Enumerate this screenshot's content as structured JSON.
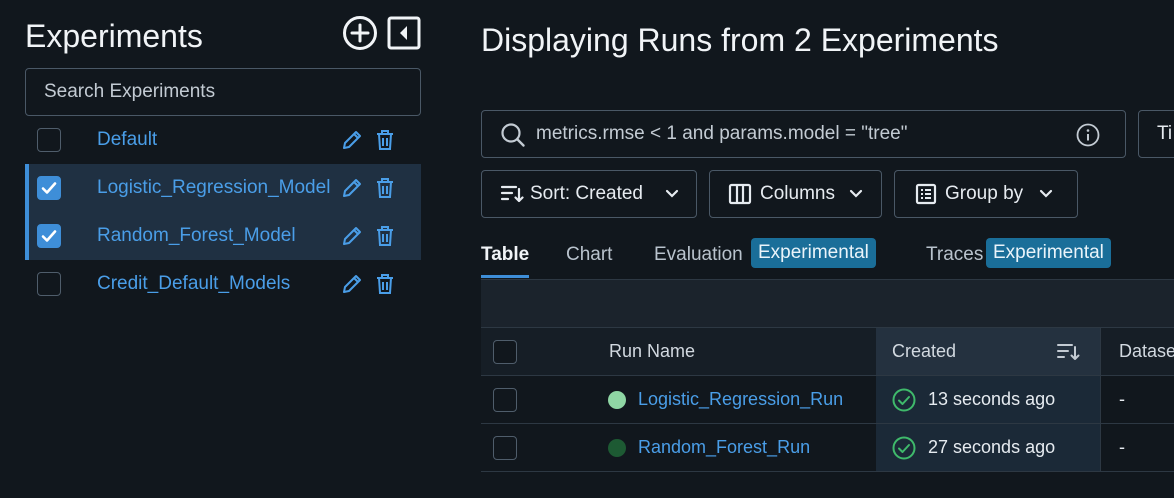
{
  "sidebar": {
    "title": "Experiments",
    "search_placeholder": "Search Experiments",
    "experiments": [
      {
        "name": "Default",
        "checked": false
      },
      {
        "name": "Logistic_Regression_Model",
        "checked": true
      },
      {
        "name": "Random_Forest_Model",
        "checked": true
      },
      {
        "name": "Credit_Default_Models",
        "checked": false
      }
    ]
  },
  "main": {
    "title": "Displaying Runs from 2 Experiments",
    "filter_query": "metrics.rmse < 1 and params.model = \"tree\"",
    "time_button_label": "Ti",
    "sort_label": "Sort: Created",
    "columns_label": "Columns",
    "group_by_label": "Group by",
    "tabs": [
      {
        "label": "Table",
        "active": true
      },
      {
        "label": "Chart",
        "active": false
      },
      {
        "label": "Evaluation",
        "badge": "Experimental"
      },
      {
        "label": "Traces",
        "badge": "Experimental"
      }
    ],
    "table": {
      "headers": {
        "run_name": "Run Name",
        "created": "Created",
        "dataset": "Datase"
      },
      "rows": [
        {
          "run_name": "Logistic_Regression_Run",
          "dot_color": "#8fd6a4",
          "created": "13 seconds ago",
          "dataset": "-"
        },
        {
          "run_name": "Random_Forest_Run",
          "dot_color": "#1d5a33",
          "created": "27 seconds ago",
          "dataset": "-"
        }
      ]
    }
  },
  "colors": {
    "background": "#11171d",
    "accent": "#3e8ed8",
    "link": "#4a9ee8",
    "badge": "#1a6e99",
    "success": "#3fb96b"
  }
}
